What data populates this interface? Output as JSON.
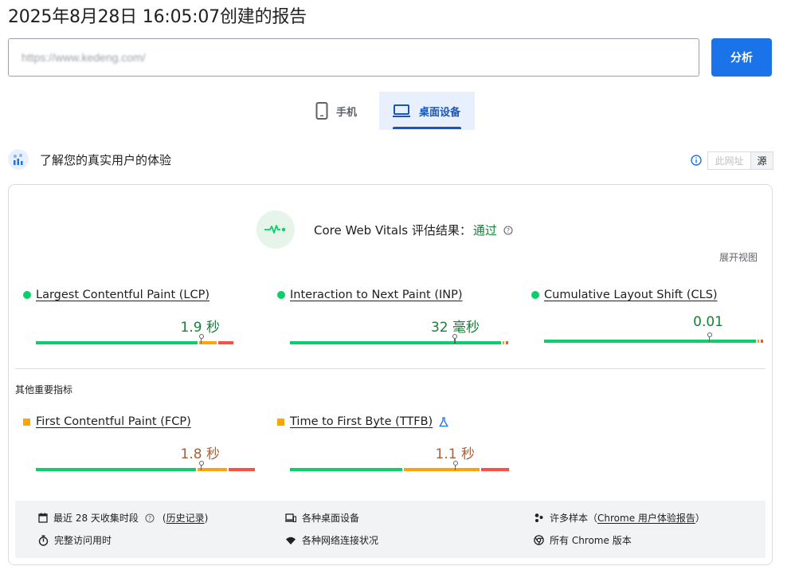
{
  "title": "2025年8月28日 16:05:07创建的报告",
  "url_input": {
    "value": "https://www.kedeng.com/"
  },
  "analyze_button": "分析",
  "tabs": {
    "mobile": "手机",
    "desktop": "桌面设备",
    "active": "desktop"
  },
  "section": {
    "title": "了解您的真实用户的体验",
    "toggle": [
      "此网址",
      "源"
    ]
  },
  "cwv": {
    "label": "Core Web Vitals 评估结果：",
    "result": "通过",
    "expand": "展开视图"
  },
  "core_metrics": [
    {
      "name": "Largest Contentful Paint (LCP)",
      "value": "1.9 秒",
      "status": "good",
      "distribution": [
        0.75,
        0.08,
        0.07
      ],
      "marker": 0.75
    },
    {
      "name": "Interaction to Next Paint (INP)",
      "value": "32 毫秒",
      "status": "good",
      "distribution": [
        0.98,
        0.01,
        0.01
      ],
      "marker": 0.75
    },
    {
      "name": "Cumulative Layout Shift (CLS)",
      "value": "0.01",
      "status": "good",
      "distribution": [
        0.98,
        0.01,
        0.01
      ],
      "marker": 0.75
    }
  ],
  "other_title": "其他重要指标",
  "other_metrics": [
    {
      "name": "First Contentful Paint (FCP)",
      "value": "1.8 秒",
      "status": "needs-improvement",
      "distribution": [
        0.74,
        0.14,
        0.12
      ],
      "marker": 0.75
    },
    {
      "name": "Time to First Byte (TTFB)",
      "value": "1.1 秒",
      "status": "needs-improvement",
      "distribution": [
        0.52,
        0.35,
        0.13
      ],
      "marker": 0.75,
      "experimental": true
    }
  ],
  "footer": {
    "period": "最近 28 天收集时段",
    "history": "历史记录",
    "devices": "各种桌面设备",
    "samples_prefix": "许多样本（",
    "samples_link": "Chrome 用户体验报告",
    "samples_suffix": "）",
    "duration": "完整访问用时",
    "network": "各种网络连接状况",
    "chrome": "所有 Chrome 版本"
  },
  "colors": {
    "good": "#0cce6b",
    "average": "#ffa400",
    "poor": "#ff4e42",
    "accent": "#1a73e8"
  },
  "icons": [
    "phone-icon",
    "laptop-icon",
    "users-chart-icon",
    "info-icon",
    "pulse-icon",
    "help-icon",
    "calendar-icon",
    "devices-icon",
    "people-icon",
    "stopwatch-icon",
    "wifi-icon",
    "chrome-icon",
    "flask-icon"
  ]
}
